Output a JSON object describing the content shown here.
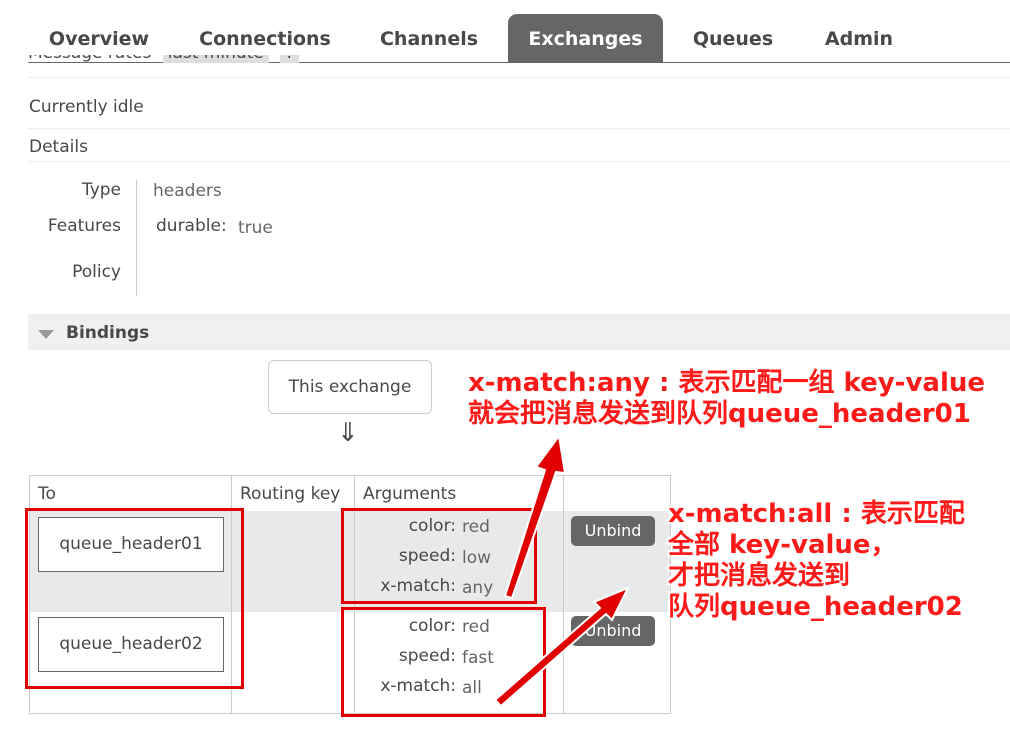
{
  "nav": {
    "tabs": [
      {
        "label": "Overview",
        "active": false
      },
      {
        "label": "Connections",
        "active": false
      },
      {
        "label": "Channels",
        "active": false
      },
      {
        "label": "Exchanges",
        "active": true
      },
      {
        "label": "Queues",
        "active": false
      },
      {
        "label": "Admin",
        "active": false
      }
    ]
  },
  "message_rates": {
    "label": "Message rates",
    "period": "last minute",
    "help": "?"
  },
  "status": "Currently idle",
  "details": {
    "heading": "Details",
    "type_label": "Type",
    "type_value": "headers",
    "features_label": "Features",
    "features_key": "durable:",
    "features_value": "true",
    "policy_label": "Policy"
  },
  "bindings": {
    "heading": "Bindings",
    "this_exchange": "This exchange",
    "arrow": "⇓",
    "columns": {
      "to": "To",
      "routing_key": "Routing key",
      "arguments": "Arguments"
    },
    "rows": [
      {
        "queue": "queue_header01",
        "arguments": [
          {
            "key": "color:",
            "value": "red"
          },
          {
            "key": "speed:",
            "value": "low"
          },
          {
            "key": "x-match:",
            "value": "any"
          }
        ],
        "unbind": "Unbind"
      },
      {
        "queue": "queue_header02",
        "arguments": [
          {
            "key": "color:",
            "value": "red"
          },
          {
            "key": "speed:",
            "value": "fast"
          },
          {
            "key": "x-match:",
            "value": "all"
          }
        ],
        "unbind": "Unbind"
      }
    ]
  },
  "annotations": {
    "any": [
      "x-match:any : 表示匹配一组 key-value",
      "就会把消息发送到队列queue_header01"
    ],
    "all": [
      "x-match:all : 表示匹配",
      "全部 key-value，",
      "才把消息发送到",
      "队列queue_header02"
    ],
    "color": "#e00000"
  }
}
